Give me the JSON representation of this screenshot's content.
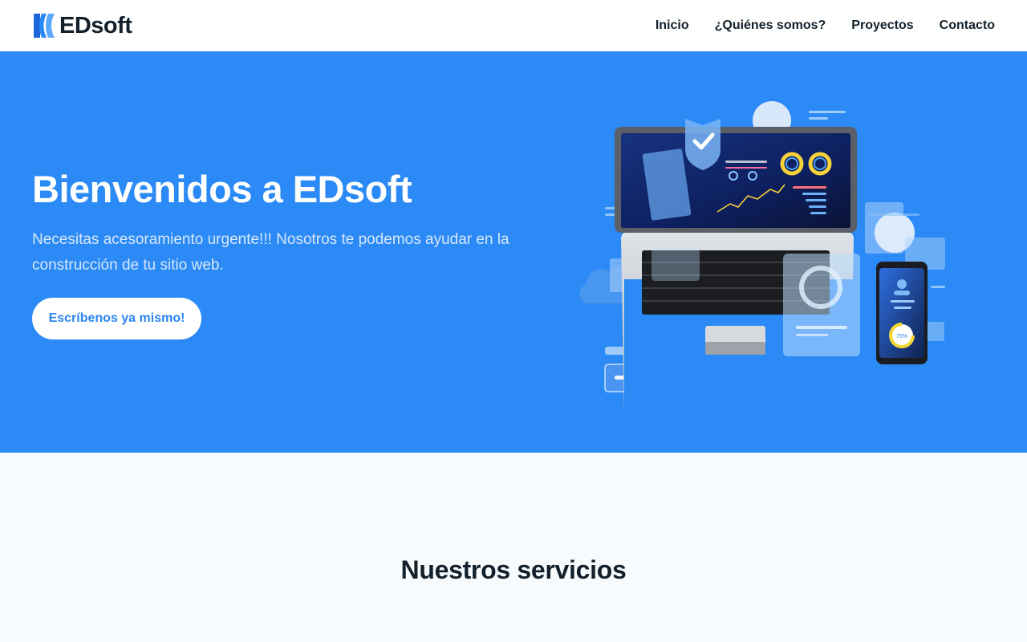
{
  "brand": {
    "name": "EDsoft",
    "logo_icon": "logo-icon",
    "color": "#2b8af5"
  },
  "nav": {
    "items": [
      {
        "label": "Inicio"
      },
      {
        "label": "¿Quiénes somos?"
      },
      {
        "label": "Proyectos"
      },
      {
        "label": "Contacto"
      }
    ]
  },
  "hero": {
    "title": "Bienvenidos a EDsoft",
    "description": "Necesitas acesoramiento urgente!!! Nosotros te podemos ayudar en la construcción de tu sitio web.",
    "cta_label": "Escríbenos ya mismo!",
    "background": "#2b8af5",
    "illustration": {
      "icon": "laptop-dashboard-illustration",
      "donut_label": "75%"
    }
  },
  "services": {
    "title": "Nuestros servicios"
  }
}
